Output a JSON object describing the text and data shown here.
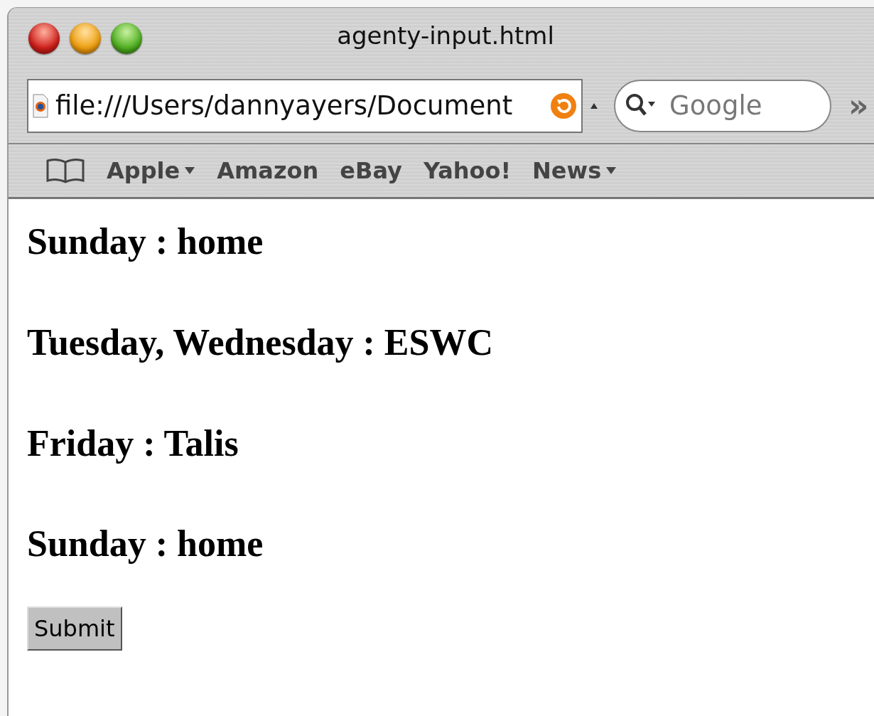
{
  "window": {
    "title": "agenty-input.html"
  },
  "toolbar": {
    "address": "file:///Users/dannyayers/Document",
    "search": {
      "placeholder": "Google"
    },
    "overflow": "»"
  },
  "bookmarks": [
    {
      "label": "Apple",
      "menu": true
    },
    {
      "label": "Amazon",
      "menu": false
    },
    {
      "label": "eBay",
      "menu": false
    },
    {
      "label": "Yahoo!",
      "menu": false
    },
    {
      "label": "News",
      "menu": true
    }
  ],
  "content": {
    "lines": [
      "Sunday : home",
      "Tuesday, Wednesday : ESWC",
      "Friday : Talis",
      "Sunday : home"
    ],
    "button": "Submit"
  }
}
